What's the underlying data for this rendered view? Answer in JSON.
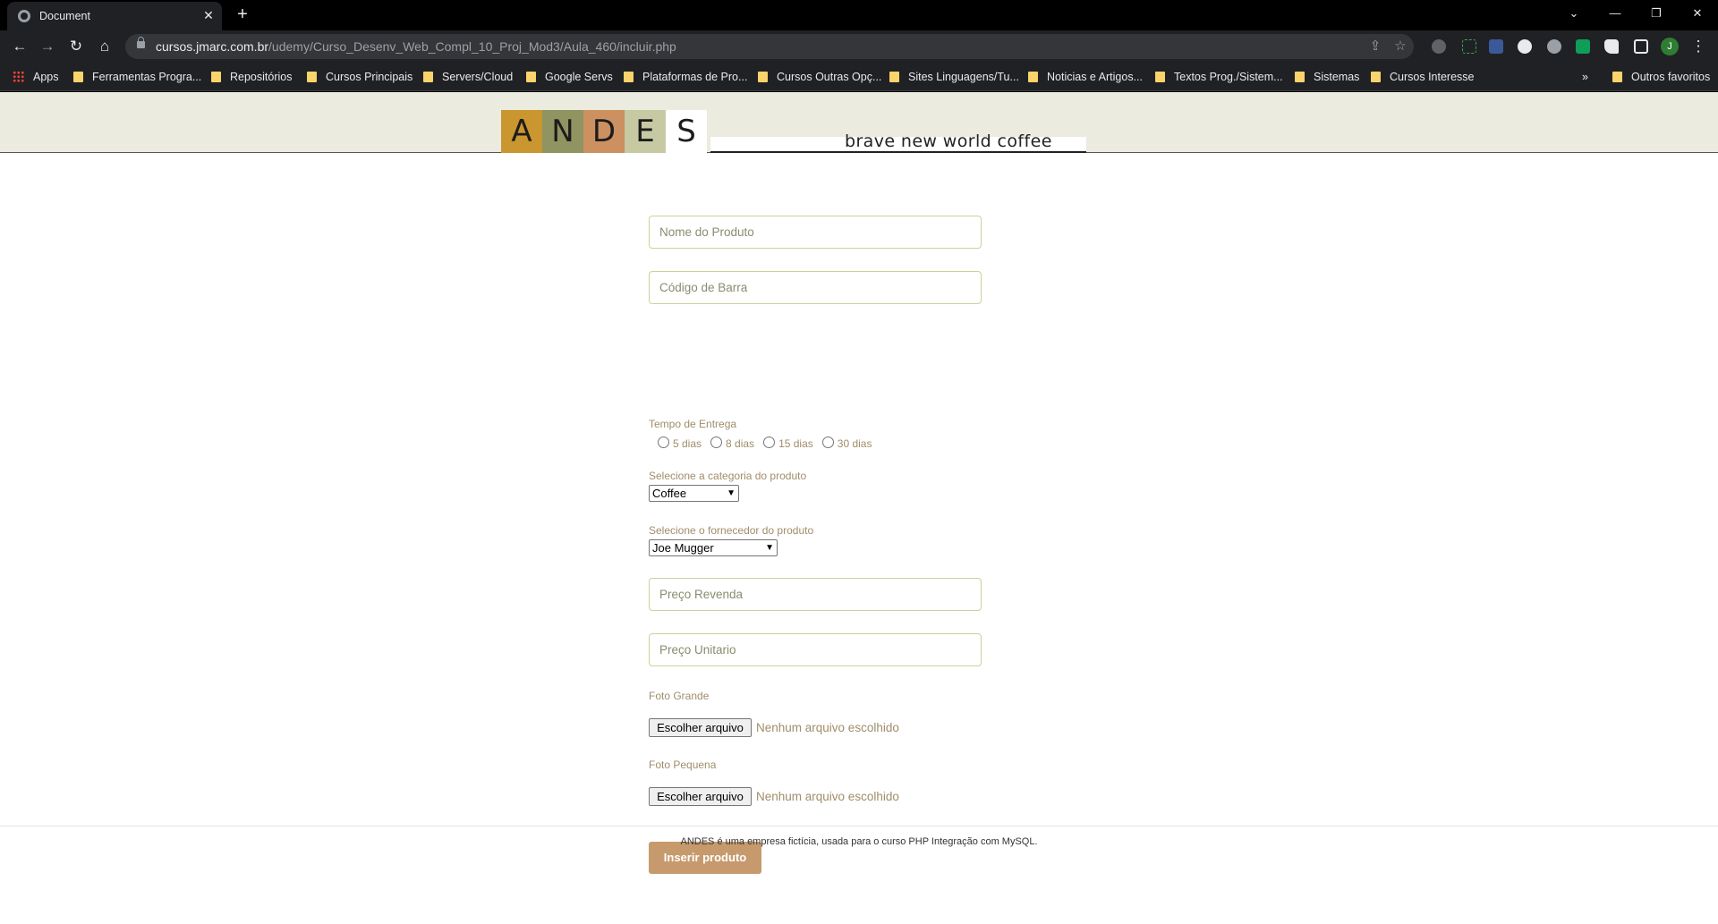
{
  "browser": {
    "tab_title": "Document",
    "tab_close": "✕",
    "new_tab": "+",
    "url_host": "cursos.jmarc.com.br",
    "url_path": "/udemy/Curso_Desenv_Web_Compl_10_Proj_Mod3/Aula_460/incluir.php",
    "avatar_letter": "J",
    "bookmarks": [
      "Apps",
      "Ferramentas Progra...",
      "Repositórios",
      "Cursos Principais",
      "Servers/Cloud",
      "Google Servs",
      "Plataformas de Pro...",
      "Cursos Outras Opç...",
      "Sites Linguagens/Tu...",
      "Noticias e Artigos...",
      "Textos Prog./Sistem...",
      "Sistemas",
      "Cursos Interesse"
    ],
    "bookmarks_overflow": "»",
    "other_bookmarks": "Outros favoritos"
  },
  "site": {
    "logo_letters": [
      "A",
      "N",
      "D",
      "E",
      "S"
    ],
    "logo_colors": [
      "#c9962f",
      "#8f9461",
      "#cd9060",
      "#c6c9a2",
      "#ffffff"
    ],
    "tagline": "brave new world coffee"
  },
  "form": {
    "nome_placeholder": "Nome do Produto",
    "codigo_placeholder": "Código de Barra",
    "tempo_label": "Tempo de Entrega",
    "tempo_options": [
      "5 dias",
      "8 dias",
      "15 dias",
      "30 dias"
    ],
    "categoria_label": "Selecione a categoria do produto",
    "categoria_value": "Coffee",
    "fornecedor_label": "Selecione o fornecedor do produto",
    "fornecedor_value": "Joe Mugger",
    "revenda_placeholder": "Preço Revenda",
    "unitario_placeholder": "Preço Unitario",
    "foto_grande_label": "Foto Grande",
    "foto_pequena_label": "Foto Pequena",
    "file_button": "Escolher arquivo",
    "file_status": "Nenhum arquivo escolhido",
    "submit_label": "Inserir produto"
  },
  "footer": {
    "text": "ANDES é uma empresa fictícia, usada para o curso PHP Integração com MySQL."
  },
  "colors": {
    "accent_button": "#c69a6d",
    "label_color": "#a08d6a",
    "header_bg": "#ecebdf"
  }
}
